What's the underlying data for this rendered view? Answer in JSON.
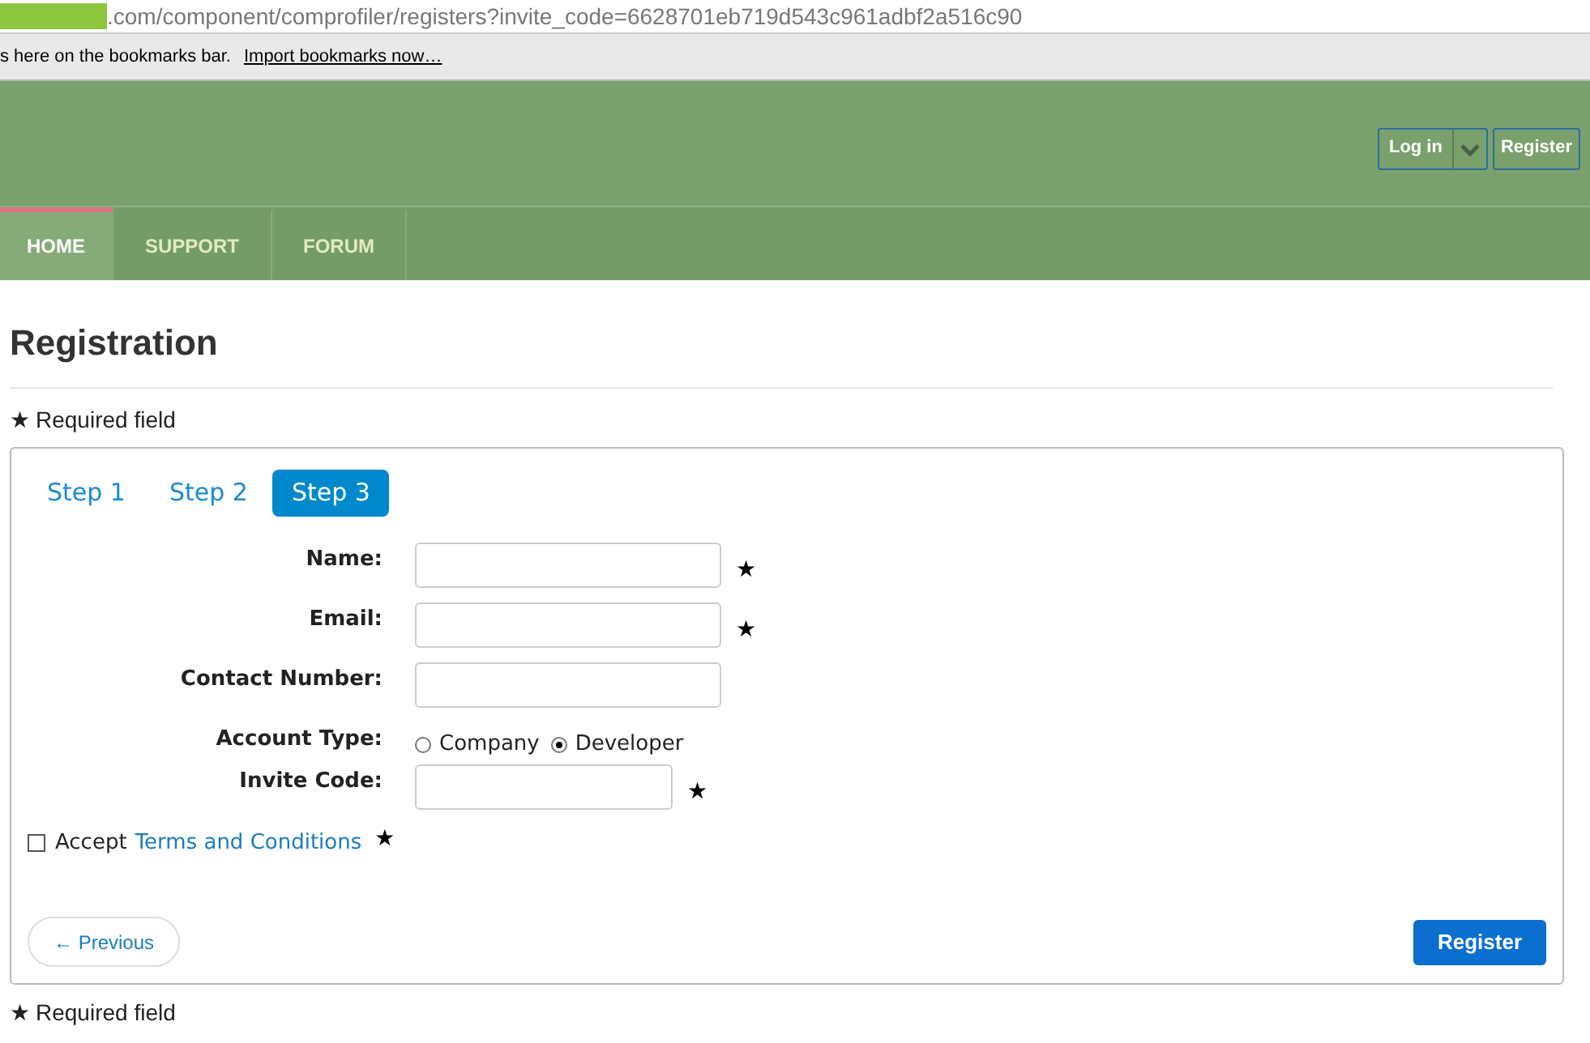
{
  "browser": {
    "url": ".com/component/comprofiler/registers?invite_code=6628701eb719d543c961adbf2a516c90",
    "bookmarks_text": "s here on the bookmarks bar.",
    "bookmarks_link": "Import bookmarks now…"
  },
  "header": {
    "login": "Log in",
    "register": "Register"
  },
  "nav": [
    {
      "label": "HOME",
      "selected": true
    },
    {
      "label": "SUPPORT",
      "selected": false
    },
    {
      "label": "FORUM",
      "selected": false
    }
  ],
  "page_title": "Registration",
  "required_note_top": {
    "star": "★",
    "text": "Required field"
  },
  "steps": [
    {
      "label": "Step 1",
      "selected": false
    },
    {
      "label": "Step 2",
      "selected": false
    },
    {
      "label": "Step 3",
      "selected": true
    }
  ],
  "fields": [
    {
      "kind": "text",
      "label": "Name:",
      "required_mark": "★"
    },
    {
      "kind": "text",
      "label": "Email:",
      "required_mark": "★"
    },
    {
      "kind": "text",
      "label": "Contact Number:"
    },
    {
      "kind": "radio",
      "label": "Account Type:",
      "options": [
        {
          "label": "Company",
          "selected": false
        },
        {
          "label": "Developer",
          "selected": true
        }
      ]
    },
    {
      "kind": "short_text",
      "label": "Invite Code:",
      "required_mark": "★"
    }
  ],
  "accept": {
    "checked": false,
    "text": "Accept",
    "link": "Terms and Conditions",
    "required_mark": "★"
  },
  "previous_button": "← Previous",
  "register_button": "Register",
  "required_note_bottom": {
    "star": "★",
    "text": "Required field"
  }
}
